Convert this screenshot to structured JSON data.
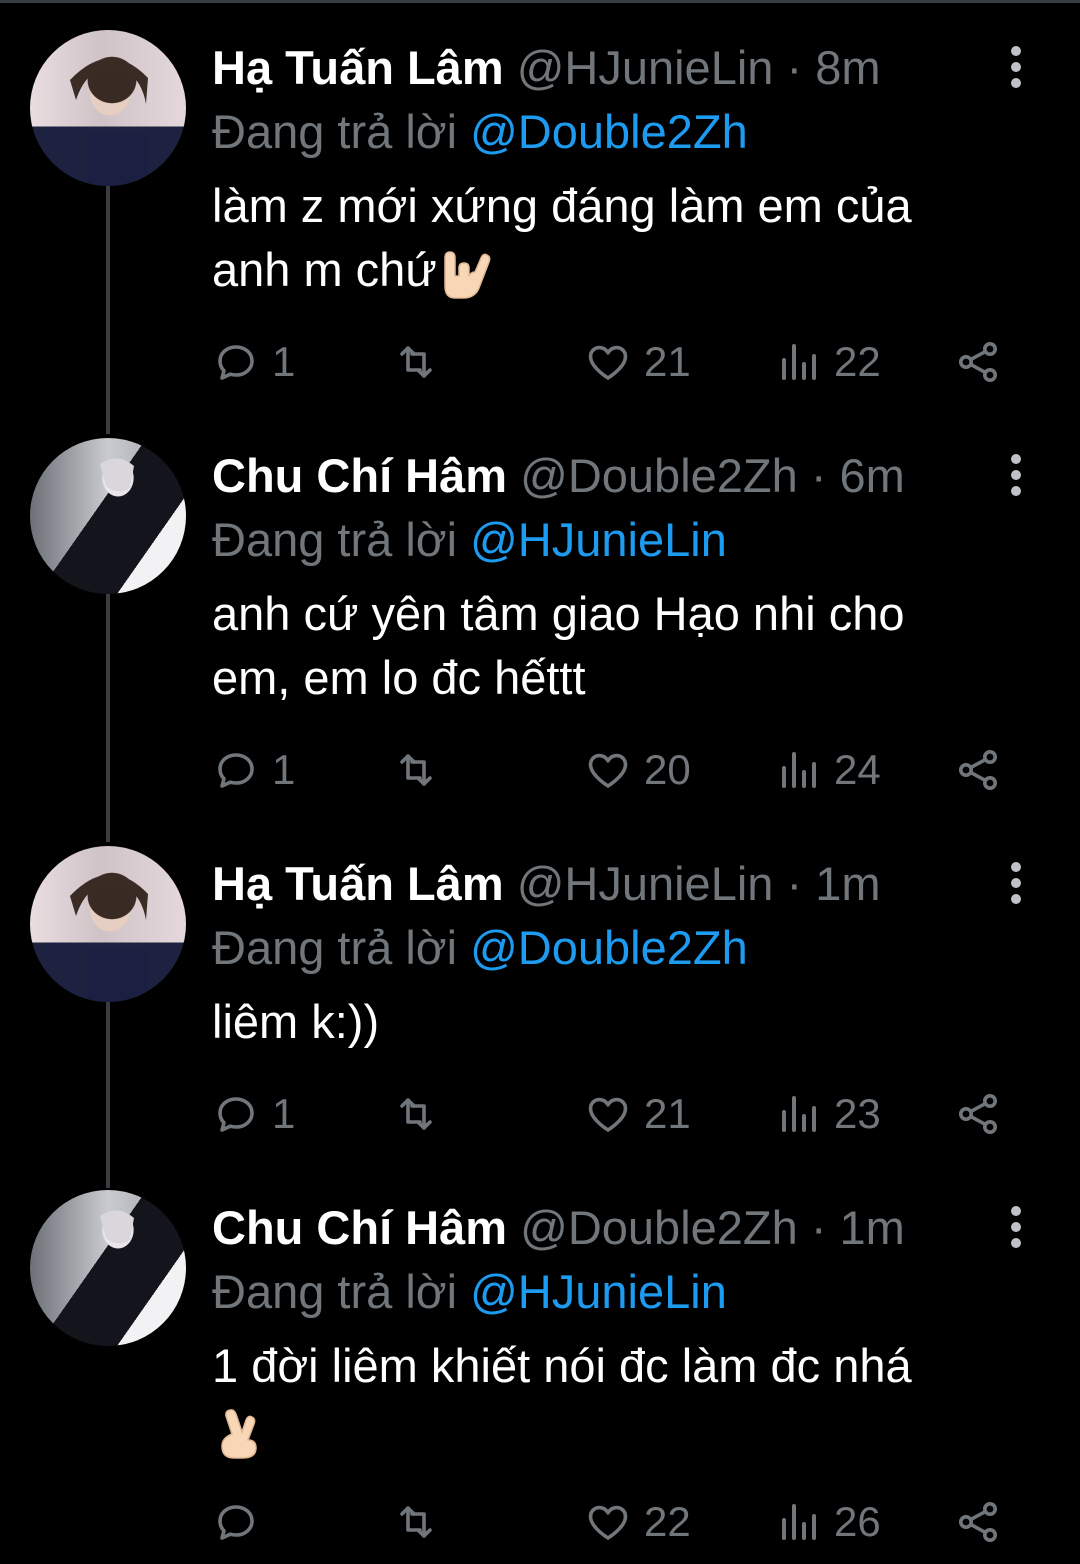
{
  "colors": {
    "background": "#000000",
    "text": "#ffffff",
    "secondary": "#71767b",
    "mention": "#1d9bf0",
    "thread_line": "#3a3d40"
  },
  "tweets": [
    {
      "name": "Hạ Tuấn Lâm",
      "handle": "@HJunieLin",
      "time": "· 8m",
      "replying_prefix": "Đang trả lời",
      "replying_to": "@Double2Zh",
      "text_line1": "làm z mới xứng đáng làm em của",
      "text_line2": "anh m chứ",
      "emoji": "love-you-gesture",
      "replies": "1",
      "retweets": "",
      "likes": "21",
      "views": "22"
    },
    {
      "name": "Chu Chí Hâm",
      "handle": "@Double2Zh",
      "time": "· 6m",
      "replying_prefix": "Đang trả lời",
      "replying_to": "@HJunieLin",
      "text_line1": "anh cứ yên tâm giao Hạo nhi cho",
      "text_line2": "em, em lo đc hếttt",
      "replies": "1",
      "retweets": "",
      "likes": "20",
      "views": "24"
    },
    {
      "name": "Hạ Tuấn Lâm",
      "handle": "@HJunieLin",
      "time": "· 1m",
      "replying_prefix": "Đang trả lời",
      "replying_to": "@Double2Zh",
      "text_line1": "liêm k:))",
      "replies": "1",
      "retweets": "",
      "likes": "21",
      "views": "23"
    },
    {
      "name": "Chu Chí Hâm",
      "handle": "@Double2Zh",
      "time": "· 1m",
      "replying_prefix": "Đang trả lời",
      "replying_to": "@HJunieLin",
      "text_line1": "1 đời liêm khiết nói đc làm đc nhá",
      "emoji": "crossed-fingers",
      "replies": "",
      "retweets": "",
      "likes": "22",
      "views": "26"
    }
  ]
}
